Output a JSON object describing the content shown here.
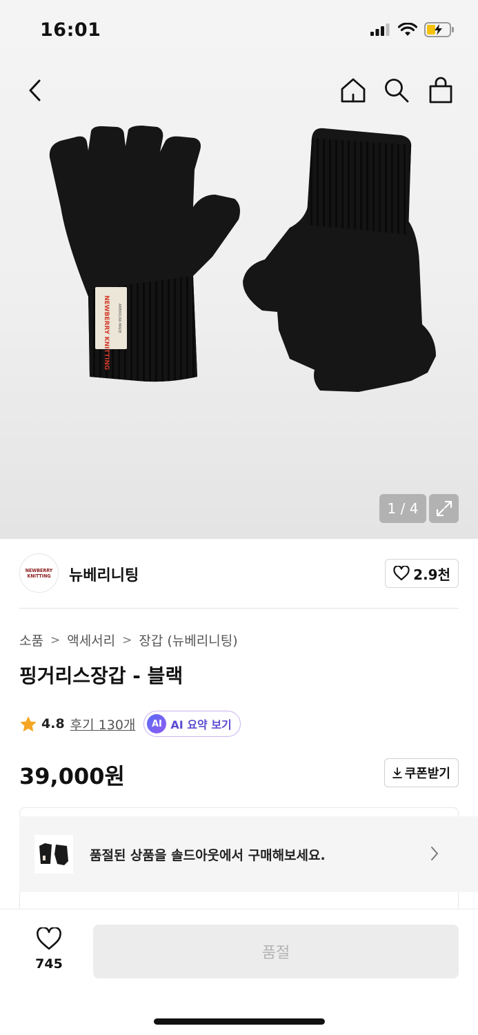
{
  "status_bar": {
    "time": "16:01",
    "icons": [
      "cellular-signal-icon",
      "wifi-icon",
      "battery-charging-icon"
    ]
  },
  "nav": {
    "icons": [
      "back-arrow-icon",
      "home-icon",
      "search-icon",
      "shopping-bag-icon"
    ]
  },
  "gallery": {
    "counter": "1 / 4",
    "expand_icon": "expand-icon",
    "label_text": "NEWBERRY KNITTING",
    "label_subtext": "AMERICAN MADE"
  },
  "brand": {
    "name": "뉴베리니팅",
    "logo_text": "NEWBERRY KNITTING",
    "likes": "2.9천"
  },
  "breadcrumb": [
    "소품",
    "액세서리",
    "장갑 (뉴베리니팅)"
  ],
  "product": {
    "title": "핑거리스장갑 - 블랙",
    "rating": "4.8",
    "review_link": "후기 130개",
    "ai_badge": "AI",
    "ai_summary": "AI 요약 보기",
    "price": "39,000원",
    "coupon": "쿠폰받기"
  },
  "soldout_banner": {
    "text": "품절된 상품을 솔드아웃에서 구매해보세요."
  },
  "bottom": {
    "wish_count": "745",
    "buy_label": "품절"
  },
  "colors": {
    "accent_purple": "#5a4bd1",
    "star": "#f5a623",
    "disabled_bg": "#ececec",
    "disabled_text": "#b3b3b3"
  }
}
